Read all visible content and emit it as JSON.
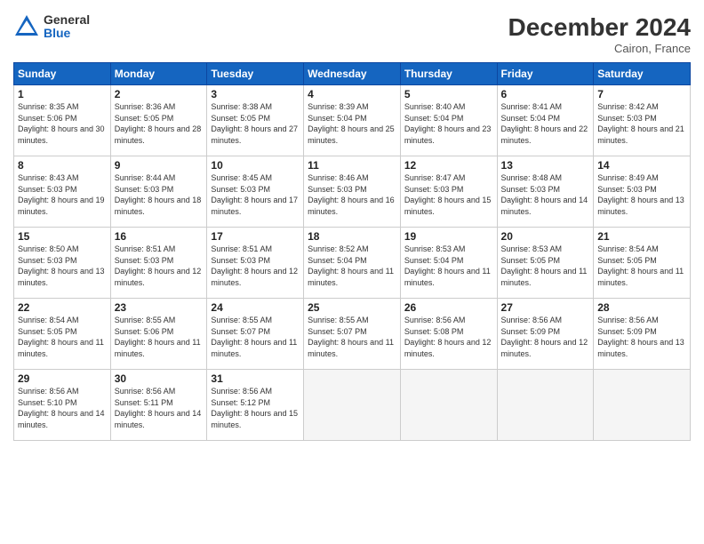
{
  "header": {
    "logo_general": "General",
    "logo_blue": "Blue",
    "month": "December 2024",
    "location": "Cairon, France"
  },
  "days_of_week": [
    "Sunday",
    "Monday",
    "Tuesday",
    "Wednesday",
    "Thursday",
    "Friday",
    "Saturday"
  ],
  "weeks": [
    [
      {
        "num": "1",
        "sunrise": "8:35 AM",
        "sunset": "5:06 PM",
        "daylight": "8 hours and 30 minutes."
      },
      {
        "num": "2",
        "sunrise": "8:36 AM",
        "sunset": "5:05 PM",
        "daylight": "8 hours and 28 minutes."
      },
      {
        "num": "3",
        "sunrise": "8:38 AM",
        "sunset": "5:05 PM",
        "daylight": "8 hours and 27 minutes."
      },
      {
        "num": "4",
        "sunrise": "8:39 AM",
        "sunset": "5:04 PM",
        "daylight": "8 hours and 25 minutes."
      },
      {
        "num": "5",
        "sunrise": "8:40 AM",
        "sunset": "5:04 PM",
        "daylight": "8 hours and 23 minutes."
      },
      {
        "num": "6",
        "sunrise": "8:41 AM",
        "sunset": "5:04 PM",
        "daylight": "8 hours and 22 minutes."
      },
      {
        "num": "7",
        "sunrise": "8:42 AM",
        "sunset": "5:03 PM",
        "daylight": "8 hours and 21 minutes."
      }
    ],
    [
      {
        "num": "8",
        "sunrise": "8:43 AM",
        "sunset": "5:03 PM",
        "daylight": "8 hours and 19 minutes."
      },
      {
        "num": "9",
        "sunrise": "8:44 AM",
        "sunset": "5:03 PM",
        "daylight": "8 hours and 18 minutes."
      },
      {
        "num": "10",
        "sunrise": "8:45 AM",
        "sunset": "5:03 PM",
        "daylight": "8 hours and 17 minutes."
      },
      {
        "num": "11",
        "sunrise": "8:46 AM",
        "sunset": "5:03 PM",
        "daylight": "8 hours and 16 minutes."
      },
      {
        "num": "12",
        "sunrise": "8:47 AM",
        "sunset": "5:03 PM",
        "daylight": "8 hours and 15 minutes."
      },
      {
        "num": "13",
        "sunrise": "8:48 AM",
        "sunset": "5:03 PM",
        "daylight": "8 hours and 14 minutes."
      },
      {
        "num": "14",
        "sunrise": "8:49 AM",
        "sunset": "5:03 PM",
        "daylight": "8 hours and 13 minutes."
      }
    ],
    [
      {
        "num": "15",
        "sunrise": "8:50 AM",
        "sunset": "5:03 PM",
        "daylight": "8 hours and 13 minutes."
      },
      {
        "num": "16",
        "sunrise": "8:51 AM",
        "sunset": "5:03 PM",
        "daylight": "8 hours and 12 minutes."
      },
      {
        "num": "17",
        "sunrise": "8:51 AM",
        "sunset": "5:03 PM",
        "daylight": "8 hours and 12 minutes."
      },
      {
        "num": "18",
        "sunrise": "8:52 AM",
        "sunset": "5:04 PM",
        "daylight": "8 hours and 11 minutes."
      },
      {
        "num": "19",
        "sunrise": "8:53 AM",
        "sunset": "5:04 PM",
        "daylight": "8 hours and 11 minutes."
      },
      {
        "num": "20",
        "sunrise": "8:53 AM",
        "sunset": "5:05 PM",
        "daylight": "8 hours and 11 minutes."
      },
      {
        "num": "21",
        "sunrise": "8:54 AM",
        "sunset": "5:05 PM",
        "daylight": "8 hours and 11 minutes."
      }
    ],
    [
      {
        "num": "22",
        "sunrise": "8:54 AM",
        "sunset": "5:05 PM",
        "daylight": "8 hours and 11 minutes."
      },
      {
        "num": "23",
        "sunrise": "8:55 AM",
        "sunset": "5:06 PM",
        "daylight": "8 hours and 11 minutes."
      },
      {
        "num": "24",
        "sunrise": "8:55 AM",
        "sunset": "5:07 PM",
        "daylight": "8 hours and 11 minutes."
      },
      {
        "num": "25",
        "sunrise": "8:55 AM",
        "sunset": "5:07 PM",
        "daylight": "8 hours and 11 minutes."
      },
      {
        "num": "26",
        "sunrise": "8:56 AM",
        "sunset": "5:08 PM",
        "daylight": "8 hours and 12 minutes."
      },
      {
        "num": "27",
        "sunrise": "8:56 AM",
        "sunset": "5:09 PM",
        "daylight": "8 hours and 12 minutes."
      },
      {
        "num": "28",
        "sunrise": "8:56 AM",
        "sunset": "5:09 PM",
        "daylight": "8 hours and 13 minutes."
      }
    ],
    [
      {
        "num": "29",
        "sunrise": "8:56 AM",
        "sunset": "5:10 PM",
        "daylight": "8 hours and 14 minutes."
      },
      {
        "num": "30",
        "sunrise": "8:56 AM",
        "sunset": "5:11 PM",
        "daylight": "8 hours and 14 minutes."
      },
      {
        "num": "31",
        "sunrise": "8:56 AM",
        "sunset": "5:12 PM",
        "daylight": "8 hours and 15 minutes."
      },
      null,
      null,
      null,
      null
    ]
  ],
  "labels": {
    "sunrise": "Sunrise:",
    "sunset": "Sunset:",
    "daylight": "Daylight:"
  }
}
